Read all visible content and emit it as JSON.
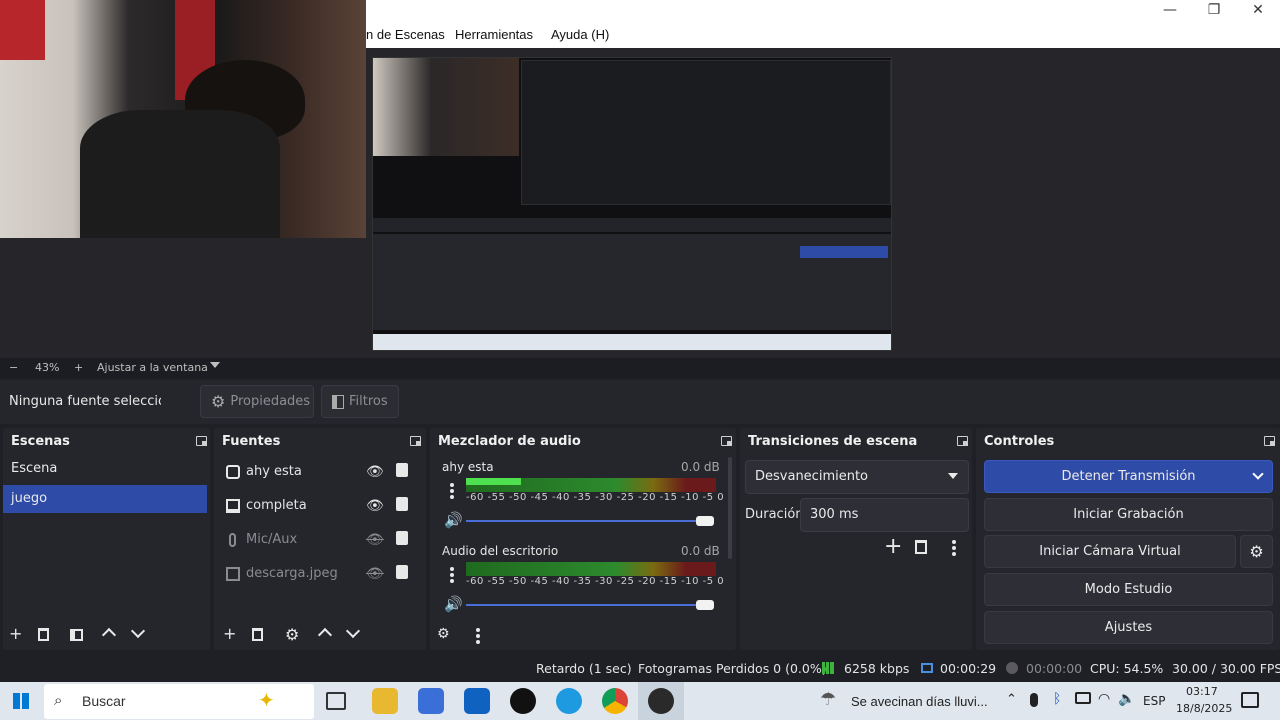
{
  "window": {
    "menu": [
      "n de Escenas",
      "Herramientas",
      "Ayuda (H)"
    ],
    "controls": {
      "minimize": "—",
      "restore": "❐",
      "close": "✕"
    }
  },
  "zoom": {
    "minus": "−",
    "percent": "43%",
    "plus": "+",
    "fit": "Ajustar a la ventana"
  },
  "source_toolbar": {
    "no_selection": "Ninguna fuente seleccionada",
    "properties": "Propiedades",
    "filters": "Filtros"
  },
  "scenes": {
    "title": "Escenas",
    "items": [
      {
        "label": "Escena",
        "active": false
      },
      {
        "label": "juego",
        "active": true
      }
    ]
  },
  "sources": {
    "title": "Fuentes",
    "items": [
      {
        "label": "ahy esta",
        "icon": "camera-icon",
        "visible": true
      },
      {
        "label": "completa",
        "icon": "monitor-icon",
        "visible": true
      },
      {
        "label": "Mic/Aux",
        "icon": "microphone-icon",
        "visible": false
      },
      {
        "label": "descarga.jpeg",
        "icon": "image-icon",
        "visible": false
      }
    ]
  },
  "mixer": {
    "title": "Mezclador de audio",
    "ticks": "-60 -55 -50 -45 -40 -35 -30 -25 -20 -15 -10 -5 0",
    "channels": [
      {
        "name": "ahy esta",
        "db": "0.0 dB",
        "level": 0.22,
        "peak": 0.5
      },
      {
        "name": "Audio del escritorio",
        "db": "0.0 dB",
        "level": 0,
        "peak": 0
      }
    ]
  },
  "transitions": {
    "title": "Transiciones de escena",
    "selected": "Desvanecimiento",
    "duration_label": "Duración",
    "duration_value": "300 ms"
  },
  "controls": {
    "title": "Controles",
    "stop_stream": "Detener Transmisión",
    "start_record": "Iniciar Grabación",
    "virtual_cam": "Iniciar Cámara Virtual",
    "studio_mode": "Modo Estudio",
    "settings": "Ajustes"
  },
  "status": {
    "delay": "Retardo (1 sec)",
    "dropped": "Fotogramas Perdidos 0 (0.0%)",
    "bitrate": "6258 kbps",
    "stream_time": "00:00:29",
    "rec_time": "00:00:00",
    "cpu": "CPU: 54.5%",
    "fps": "30.00 / 30.00 FPS"
  },
  "taskbar": {
    "search_placeholder": "Buscar",
    "weather": "Se avecinan días lluvi...",
    "lang": "ESP",
    "time": "03:17",
    "date": "18/8/2025"
  },
  "colors": {
    "accent": "#2f4ba8",
    "panel": "#25262c",
    "background": "#1f2025"
  }
}
